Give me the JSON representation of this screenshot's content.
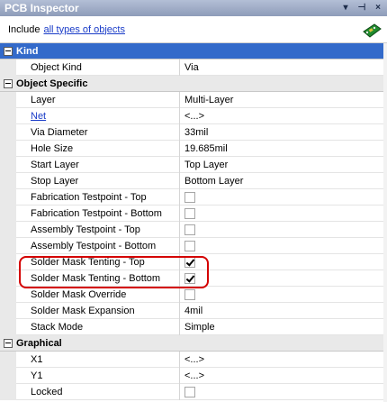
{
  "window": {
    "title": "PCB Inspector"
  },
  "title_controls": {
    "dropdown": "▾",
    "pin": "⊣",
    "close": "×"
  },
  "filter": {
    "prefix": "Include",
    "link": "all types of objects"
  },
  "categories": {
    "kind": "Kind",
    "object_specific": "Object Specific",
    "graphical": "Graphical"
  },
  "kind_rows": [
    {
      "name": "Object Kind",
      "value": "Via"
    }
  ],
  "object_rows": [
    {
      "name": "Layer",
      "value": "Multi-Layer"
    },
    {
      "name": "Net",
      "value": "<...>"
    },
    {
      "name": "Via Diameter",
      "value": "33mil"
    },
    {
      "name": "Hole Size",
      "value": "19.685mil"
    },
    {
      "name": "Start Layer",
      "value": "Top Layer"
    },
    {
      "name": "Stop Layer",
      "value": "Bottom Layer"
    },
    {
      "name": "Fabrication Testpoint - Top",
      "checked": false
    },
    {
      "name": "Fabrication Testpoint - Bottom",
      "checked": false
    },
    {
      "name": "Assembly Testpoint - Top",
      "checked": false
    },
    {
      "name": "Assembly Testpoint - Bottom",
      "checked": false
    },
    {
      "name": "Solder Mask Tenting - Top",
      "checked": true
    },
    {
      "name": "Solder Mask Tenting - Bottom",
      "checked": true
    },
    {
      "name": "Solder Mask Override",
      "checked": false
    },
    {
      "name": "Solder Mask Expansion",
      "value": "4mil"
    },
    {
      "name": "Stack Mode",
      "value": "Simple"
    }
  ],
  "graphical_rows": [
    {
      "name": "X1",
      "value": "<...>"
    },
    {
      "name": "Y1",
      "value": "<...>"
    },
    {
      "name": "Locked",
      "checked": false
    }
  ],
  "colors": {
    "title_bar": "#8e9cb9",
    "selected_category": "#336aca",
    "link": "#1a3cc8",
    "highlight": "#d40000"
  }
}
